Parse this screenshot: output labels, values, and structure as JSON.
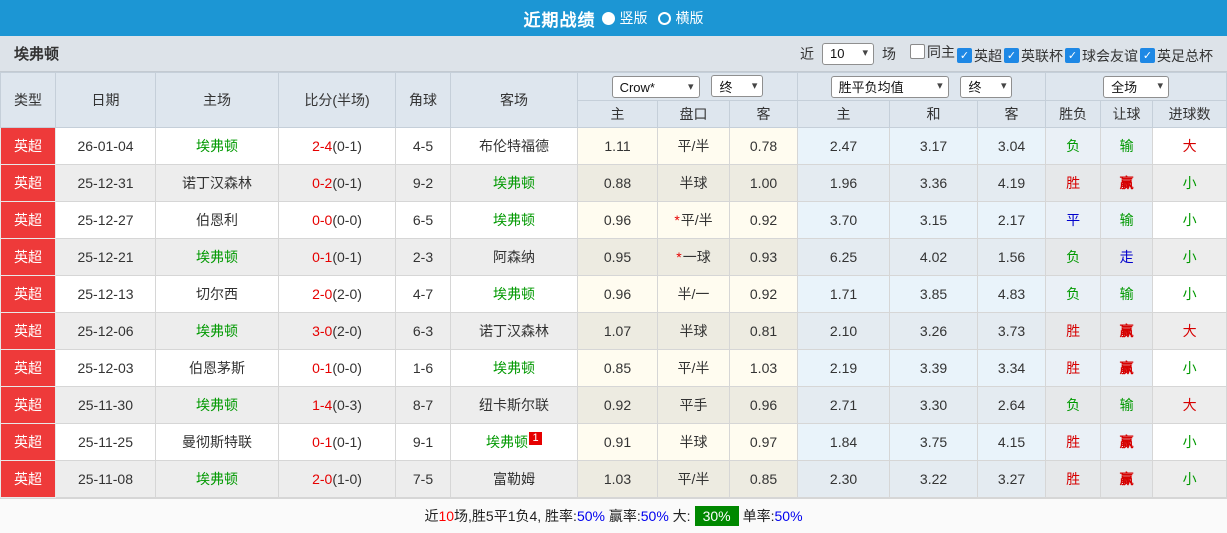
{
  "topbar": {
    "title": "近期战绩",
    "options": [
      {
        "label": "竖版",
        "selected": true
      },
      {
        "label": "横版",
        "selected": false
      }
    ]
  },
  "filterbar": {
    "team": "埃弗顿",
    "recent_label": "近",
    "count_value": "10",
    "matches_label": "场",
    "checkboxes": [
      {
        "label": "同主",
        "checked": false
      },
      {
        "label": "英超",
        "checked": true
      },
      {
        "label": "英联杯",
        "checked": true
      },
      {
        "label": "球会友谊",
        "checked": true
      },
      {
        "label": "英足总杯",
        "checked": true
      }
    ]
  },
  "table": {
    "headers": {
      "type": "类型",
      "date": "日期",
      "home": "主场",
      "score": "比分(半场)",
      "corner": "角球",
      "away": "客场"
    },
    "selects": {
      "company": "Crow*",
      "company_time": "终",
      "avg": "胜平负均值",
      "avg_time": "终",
      "scope": "全场"
    },
    "sub_headers": [
      "主",
      "盘口",
      "客",
      "主",
      "和",
      "客",
      "胜负",
      "让球",
      "进球数"
    ],
    "rows": [
      {
        "league": "英超",
        "date": "26-01-04",
        "home": "埃弗顿",
        "home_team": true,
        "score": "2-4",
        "half": "(0-1)",
        "corner": "4-5",
        "away": "布伦特福德",
        "away_team": false,
        "away_redcard": "",
        "odds_home": "1.11",
        "handicap": "平/半",
        "handicap_star": false,
        "odds_away": "0.78",
        "avg_home": "2.47",
        "avg_draw": "3.17",
        "avg_away": "3.04",
        "result": {
          "t": "负",
          "c": "green"
        },
        "let": {
          "t": "输",
          "c": "green"
        },
        "goals": {
          "t": "大",
          "c": "red"
        }
      },
      {
        "league": "英超",
        "date": "25-12-31",
        "home": "诺丁汉森林",
        "home_team": false,
        "score": "0-2",
        "half": "(0-1)",
        "corner": "9-2",
        "away": "埃弗顿",
        "away_team": true,
        "away_redcard": "",
        "odds_home": "0.88",
        "handicap": "半球",
        "handicap_star": false,
        "odds_away": "1.00",
        "avg_home": "1.96",
        "avg_draw": "3.36",
        "avg_away": "4.19",
        "result": {
          "t": "胜",
          "c": "red"
        },
        "let": {
          "t": "赢",
          "c": "red"
        },
        "goals": {
          "t": "小",
          "c": "green"
        }
      },
      {
        "league": "英超",
        "date": "25-12-27",
        "home": "伯恩利",
        "home_team": false,
        "score": "0-0",
        "half": "(0-0)",
        "corner": "6-5",
        "away": "埃弗顿",
        "away_team": true,
        "away_redcard": "",
        "odds_home": "0.96",
        "handicap": "平/半",
        "handicap_star": true,
        "odds_away": "0.92",
        "avg_home": "3.70",
        "avg_draw": "3.15",
        "avg_away": "2.17",
        "result": {
          "t": "平",
          "c": "blue"
        },
        "let": {
          "t": "输",
          "c": "green"
        },
        "goals": {
          "t": "小",
          "c": "green"
        }
      },
      {
        "league": "英超",
        "date": "25-12-21",
        "home": "埃弗顿",
        "home_team": true,
        "score": "0-1",
        "half": "(0-1)",
        "corner": "2-3",
        "away": "阿森纳",
        "away_team": false,
        "away_redcard": "",
        "odds_home": "0.95",
        "handicap": "一球",
        "handicap_star": true,
        "odds_away": "0.93",
        "avg_home": "6.25",
        "avg_draw": "4.02",
        "avg_away": "1.56",
        "result": {
          "t": "负",
          "c": "green"
        },
        "let": {
          "t": "走",
          "c": "blue"
        },
        "goals": {
          "t": "小",
          "c": "green"
        }
      },
      {
        "league": "英超",
        "date": "25-12-13",
        "home": "切尔西",
        "home_team": false,
        "score": "2-0",
        "half": "(2-0)",
        "corner": "4-7",
        "away": "埃弗顿",
        "away_team": true,
        "away_redcard": "",
        "odds_home": "0.96",
        "handicap": "半/一",
        "handicap_star": false,
        "odds_away": "0.92",
        "avg_home": "1.71",
        "avg_draw": "3.85",
        "avg_away": "4.83",
        "result": {
          "t": "负",
          "c": "green"
        },
        "let": {
          "t": "输",
          "c": "green"
        },
        "goals": {
          "t": "小",
          "c": "green"
        }
      },
      {
        "league": "英超",
        "date": "25-12-06",
        "home": "埃弗顿",
        "home_team": true,
        "score": "3-0",
        "half": "(2-0)",
        "corner": "6-3",
        "away": "诺丁汉森林",
        "away_team": false,
        "away_redcard": "",
        "odds_home": "1.07",
        "handicap": "半球",
        "handicap_star": false,
        "odds_away": "0.81",
        "avg_home": "2.10",
        "avg_draw": "3.26",
        "avg_away": "3.73",
        "result": {
          "t": "胜",
          "c": "red"
        },
        "let": {
          "t": "赢",
          "c": "red"
        },
        "goals": {
          "t": "大",
          "c": "red"
        }
      },
      {
        "league": "英超",
        "date": "25-12-03",
        "home": "伯恩茅斯",
        "home_team": false,
        "score": "0-1",
        "half": "(0-0)",
        "corner": "1-6",
        "away": "埃弗顿",
        "away_team": true,
        "away_redcard": "",
        "odds_home": "0.85",
        "handicap": "平/半",
        "handicap_star": false,
        "odds_away": "1.03",
        "avg_home": "2.19",
        "avg_draw": "3.39",
        "avg_away": "3.34",
        "result": {
          "t": "胜",
          "c": "red"
        },
        "let": {
          "t": "赢",
          "c": "red"
        },
        "goals": {
          "t": "小",
          "c": "green"
        }
      },
      {
        "league": "英超",
        "date": "25-11-30",
        "home": "埃弗顿",
        "home_team": true,
        "score": "1-4",
        "half": "(0-3)",
        "corner": "8-7",
        "away": "纽卡斯尔联",
        "away_team": false,
        "away_redcard": "",
        "odds_home": "0.92",
        "handicap": "平手",
        "handicap_star": false,
        "odds_away": "0.96",
        "avg_home": "2.71",
        "avg_draw": "3.30",
        "avg_away": "2.64",
        "result": {
          "t": "负",
          "c": "green"
        },
        "let": {
          "t": "输",
          "c": "green"
        },
        "goals": {
          "t": "大",
          "c": "red"
        }
      },
      {
        "league": "英超",
        "date": "25-11-25",
        "home": "曼彻斯特联",
        "home_team": false,
        "score": "0-1",
        "half": "(0-1)",
        "corner": "9-1",
        "away": "埃弗顿",
        "away_team": true,
        "away_redcard": "1",
        "odds_home": "0.91",
        "handicap": "半球",
        "handicap_star": false,
        "odds_away": "0.97",
        "avg_home": "1.84",
        "avg_draw": "3.75",
        "avg_away": "4.15",
        "result": {
          "t": "胜",
          "c": "red"
        },
        "let": {
          "t": "赢",
          "c": "red"
        },
        "goals": {
          "t": "小",
          "c": "green"
        }
      },
      {
        "league": "英超",
        "date": "25-11-08",
        "home": "埃弗顿",
        "home_team": true,
        "score": "2-0",
        "half": "(1-0)",
        "corner": "7-5",
        "away": "富勒姆",
        "away_team": false,
        "away_redcard": "",
        "odds_home": "1.03",
        "handicap": "平/半",
        "handicap_star": false,
        "odds_away": "0.85",
        "avg_home": "2.30",
        "avg_draw": "3.22",
        "avg_away": "3.27",
        "result": {
          "t": "胜",
          "c": "red"
        },
        "let": {
          "t": "赢",
          "c": "red"
        },
        "goals": {
          "t": "小",
          "c": "green"
        }
      }
    ]
  },
  "footer": {
    "segments": [
      {
        "t": "近",
        "c": "plain"
      },
      {
        "t": "10",
        "c": "red"
      },
      {
        "t": "场,胜5平1负4, 胜率:",
        "c": "plain"
      },
      {
        "t": "50%",
        "c": "blue"
      },
      {
        "t": " 赢率:",
        "c": "plain"
      },
      {
        "t": "50%",
        "c": "blue"
      },
      {
        "t": " 大:",
        "c": "plain"
      },
      {
        "t": "30%",
        "c": "green-badge"
      },
      {
        "t": "单率:",
        "c": "plain"
      },
      {
        "t": "50%",
        "c": "blue"
      }
    ]
  }
}
